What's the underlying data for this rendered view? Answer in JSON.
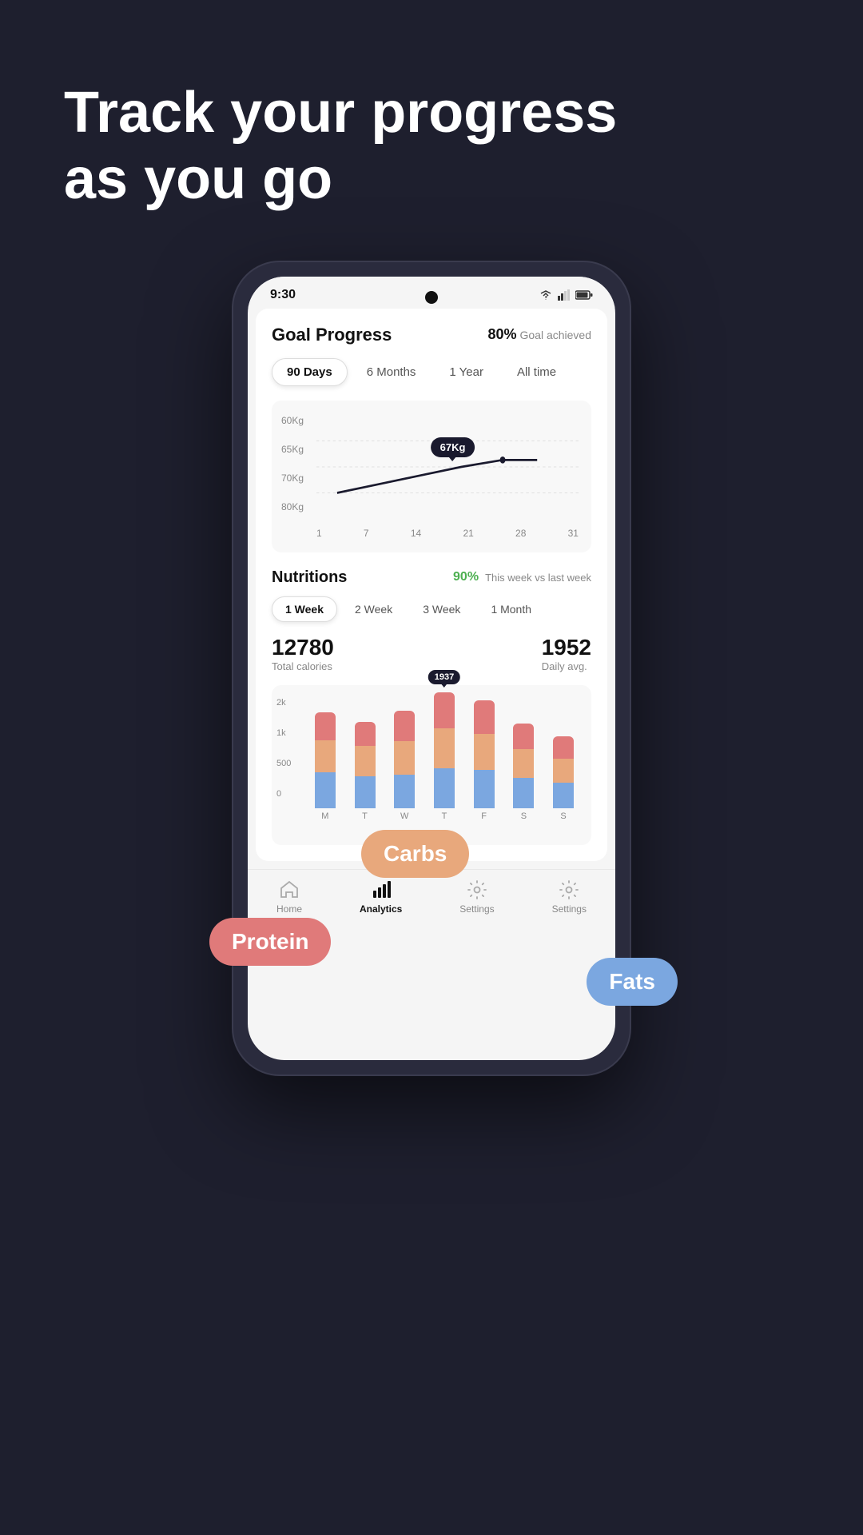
{
  "headline": {
    "line1": "Track your progress",
    "line2": "as you go"
  },
  "phone": {
    "status_bar": {
      "time": "9:30",
      "signal_icon": "signal",
      "battery_icon": "battery"
    },
    "screen": {
      "title": "Goal Progress",
      "goal_pct": "80%",
      "goal_label": "Goal achieved",
      "time_tabs": [
        {
          "label": "90 Days",
          "active": true
        },
        {
          "label": "6 Months",
          "active": false
        },
        {
          "label": "1 Year",
          "active": false
        },
        {
          "label": "All time",
          "active": false
        }
      ],
      "weight_chart": {
        "y_labels": [
          "60Kg",
          "65Kg",
          "70Kg",
          "80Kg"
        ],
        "x_labels": [
          "1",
          "7",
          "14",
          "21",
          "28",
          "31"
        ],
        "tooltip": "67Kg"
      },
      "nutrition": {
        "title": "Nutritions",
        "pct": "90%",
        "sub": "This week vs last week",
        "week_tabs": [
          {
            "label": "1 Week",
            "active": true
          },
          {
            "label": "2 Week",
            "active": false
          },
          {
            "label": "3 Week",
            "active": false
          },
          {
            "label": "1 Month",
            "active": false
          }
        ],
        "total_calories_value": "12780",
        "total_calories_label": "Total calories",
        "daily_avg_value": "1952",
        "daily_avg_label": "Daily avg.",
        "bar_chart": {
          "y_labels": [
            "2k",
            "1k",
            "500",
            "0"
          ],
          "tooltip_day": "T",
          "tooltip_value": "1937",
          "days": [
            "M",
            "T",
            "W",
            "T",
            "F",
            "S",
            "S"
          ],
          "bars": [
            {
              "day": "M",
              "protein": 35,
              "carbs": 40,
              "fats": 45
            },
            {
              "day": "T",
              "protein": 30,
              "carbs": 38,
              "fats": 40
            },
            {
              "day": "W",
              "protein": 38,
              "carbs": 42,
              "fats": 42
            },
            {
              "day": "T",
              "protein": 45,
              "carbs": 50,
              "fats": 50,
              "tooltip": "1937"
            },
            {
              "day": "F",
              "protein": 42,
              "carbs": 45,
              "fats": 48
            },
            {
              "day": "S",
              "protein": 32,
              "carbs": 36,
              "fats": 38
            },
            {
              "day": "S",
              "protein": 28,
              "carbs": 30,
              "fats": 32
            }
          ]
        }
      }
    }
  },
  "floating_labels": {
    "protein": "Protein",
    "carbs": "Carbs",
    "fats": "Fats"
  },
  "bottom_nav": {
    "items": [
      {
        "label": "Home",
        "active": false
      },
      {
        "label": "Analytics",
        "active": true
      },
      {
        "label": "Settings",
        "active": false
      },
      {
        "label": "Settings",
        "active": false
      }
    ]
  }
}
